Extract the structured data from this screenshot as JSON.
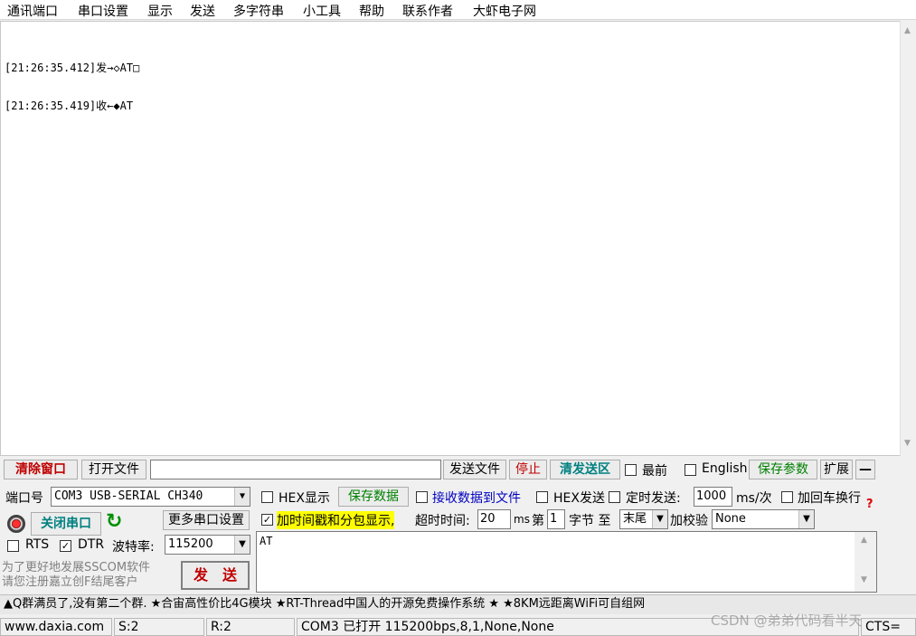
{
  "menu": {
    "items": [
      "通讯端口",
      "串口设置",
      "显示",
      "发送",
      "多字符串",
      "小工具",
      "帮助",
      "联系作者",
      "大虾电子网"
    ]
  },
  "receive": {
    "line1": "[21:26:35.412]发→◇AT□",
    "line2": "[21:26:35.419]收←◆AT"
  },
  "toolbar": {
    "clear_window": "清除窗口",
    "open_file": "打开文件",
    "send_file": "发送文件",
    "stop": "停止",
    "clear_send_area": "清发送区",
    "last": "最前",
    "english": "English",
    "save_params": "保存参数",
    "expand": "扩展",
    "collapse": "—"
  },
  "port": {
    "label": "端口号",
    "value": "COM3 USB-SERIAL CH340",
    "close_port": "关闭串口",
    "more_settings": "更多串口设置",
    "rts": "RTS",
    "dtr": "DTR",
    "baud_label": "波特率:",
    "baud_value": "115200"
  },
  "options": {
    "hex_display": "HEX显示",
    "save_data": "保存数据",
    "recv_to_file": "接收数据到文件",
    "hex_send": "HEX发送",
    "timed_send": "定时发送:",
    "interval": "1000",
    "interval_unit": "ms/次",
    "add_crlf": "加回车换行",
    "timestamp": "加时间戳和分包显示,",
    "timeout_label": "超时时间:",
    "timeout_value": "20",
    "timeout_unit": "ms",
    "byte_pre": "第",
    "byte_num": "1",
    "byte_post": "字节 至",
    "end_select": "末尾",
    "checksum_label": "加校验",
    "checksum_value": "None"
  },
  "send": {
    "text": "AT",
    "button": "发　送",
    "hint1": "为了更好地发展SSCOM软件",
    "hint2": "请您注册嘉立创F结尾客户"
  },
  "ticker": {
    "text": "▲Q群满员了,没有第二个群. ★合宙高性价比4G模块 ★RT-Thread中国人的开源免费操作系统 ★ ★8KM远距离WiFi可自组网"
  },
  "status": {
    "site": "www.daxia.com",
    "sent": "S:2",
    "received": "R:2",
    "port_state": "COM3 已打开  115200bps,8,1,None,None",
    "watermark": "CSDN @弟弟代码看半天",
    "cts": "CTS="
  }
}
